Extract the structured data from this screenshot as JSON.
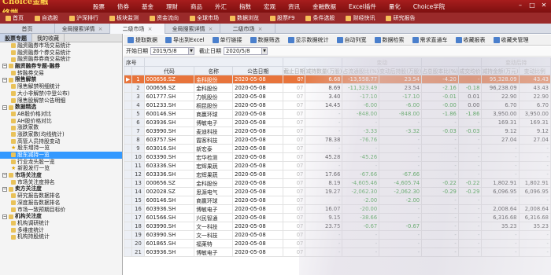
{
  "app": {
    "logo_text": "Choice金融终端",
    "menu": [
      "股票",
      "债券",
      "基金",
      "理财",
      "商品",
      "外汇",
      "指数",
      "宏观",
      "资讯",
      "金融数据",
      "Excel插件",
      "量化",
      "Choice学院"
    ],
    "window_controls": [
      "minimize-icon",
      "maximize-icon",
      "close-icon"
    ]
  },
  "quick_tools": [
    "首页",
    "自选股",
    "沪深排行",
    "板块监测",
    "资金流向",
    "全球市场",
    "数据浏览",
    "股票F9",
    "条件选股",
    "财经快讯",
    "研究报告"
  ],
  "tabs": [
    {
      "label": "首页",
      "active": false
    },
    {
      "label": "全局搜索详情",
      "active": false
    },
    {
      "label": "二级市场",
      "active": true
    },
    {
      "label": "全局搜索详情",
      "active": false
    },
    {
      "label": "二级市场",
      "active": false
    }
  ],
  "sidebar": {
    "tabs": [
      "股票专题",
      "我的收藏"
    ],
    "items": [
      {
        "label": "融资融券市场交易统计",
        "level": 2,
        "kind": "leaf"
      },
      {
        "label": "融资融券个券交易统计",
        "level": 2,
        "kind": "leaf"
      },
      {
        "label": "融资融券券商交易统计",
        "level": 2,
        "kind": "leaf"
      },
      {
        "label": "融资融券专题-融券",
        "level": 1,
        "kind": "group"
      },
      {
        "label": "转融券交易",
        "level": 2,
        "kind": "leaf"
      },
      {
        "label": "限售解禁",
        "level": 1,
        "kind": "group"
      },
      {
        "label": "限售解禁明细统计",
        "level": 2,
        "kind": "leaf"
      },
      {
        "label": "大小非解禁(中登公布)",
        "level": 2,
        "kind": "leaf"
      },
      {
        "label": "限售股解禁公告明细",
        "level": 2,
        "kind": "leaf"
      },
      {
        "label": "数据精选",
        "level": 1,
        "kind": "group"
      },
      {
        "label": "AB股价格对比",
        "level": 2,
        "kind": "leaf"
      },
      {
        "label": "AH股价格对比",
        "level": 2,
        "kind": "leaf"
      },
      {
        "label": "涨跌家数",
        "level": 2,
        "kind": "leaf"
      },
      {
        "label": "涨跌家数(均线统计)",
        "level": 2,
        "kind": "leaf"
      },
      {
        "label": "高管人员持股变动",
        "level": 2,
        "kind": "leaf"
      },
      {
        "label": "股东增持一览",
        "level": 2,
        "kind": "star"
      },
      {
        "label": "股东减持一览",
        "level": 2,
        "kind": "selected"
      },
      {
        "label": "行业龙头股一览",
        "level": 2,
        "kind": "leaf"
      },
      {
        "label": "新股发行一览",
        "level": 2,
        "kind": "star"
      },
      {
        "label": "市场关注度",
        "level": 1,
        "kind": "group"
      },
      {
        "label": "市场关注度排名",
        "level": 2,
        "kind": "leaf"
      },
      {
        "label": "卖方关注度",
        "level": 1,
        "kind": "group"
      },
      {
        "label": "研究报告数据排名",
        "level": 2,
        "kind": "leaf"
      },
      {
        "label": "深度报告数据排名",
        "level": 2,
        "kind": "leaf"
      },
      {
        "label": "市场一致预期目标价",
        "level": 2,
        "kind": "leaf"
      },
      {
        "label": "机构关注度",
        "level": 1,
        "kind": "group"
      },
      {
        "label": "机构调研统计",
        "level": 2,
        "kind": "leaf"
      },
      {
        "label": "多维度统计",
        "level": 2,
        "kind": "leaf"
      },
      {
        "label": "机构持股统计",
        "level": 2,
        "kind": "leaf"
      }
    ]
  },
  "actions": [
    "提取数据",
    "导出到Excel",
    "单行链接",
    "数据筛选",
    "显示数据统计",
    "自动列宽",
    "数据检索",
    "需求直通车",
    "收藏报表",
    "收藏夹管理"
  ],
  "filters": {
    "start_label": "开始日期",
    "start_value": "2019/5/8",
    "end_label": "截止日期",
    "end_value": "2020/5/8"
  },
  "table": {
    "headers": [
      "序号",
      "代码",
      "名称",
      "公告日期",
      "截止日期",
      "减持数量(万股)",
      "占流通股比(%)",
      "变动后持股(万股)",
      "占总股本比(%)",
      "成交均价",
      "减持金额(万元)",
      "变动比例",
      "增减持日期",
      "交易方式",
      "变动(万元)"
    ],
    "group_headers": [
      "变动",
      "变动后持"
    ],
    "rows": [
      {
        "idx": "1",
        "code": "000656.SZ",
        "name": "金科股份",
        "date": "2020-05-08",
        "c1": "0?",
        "c2": "6.68",
        "c3": "-13,558.77",
        "c4": "23.54",
        "c5": "-4.20",
        "c6": "-",
        "c7": "95,328.09",
        "c8": "43.43"
      },
      {
        "idx": "2",
        "code": "000656.SZ",
        "name": "金科股份",
        "date": "2020-05-08",
        "c1": "07",
        "c2": "8.69",
        "c3": "-11,323.49",
        "c4": "23.54",
        "c5": "-2.16",
        "c6": "-0.18",
        "c7": "96,238.09",
        "c8": "43.43"
      },
      {
        "idx": "3",
        "code": "601777.SH",
        "name": "力帆股份",
        "date": "2020-05-08",
        "c1": "07",
        "c2": "3.40",
        "c3": "-17.10",
        "c4": "-17.10",
        "c5": "-0.01",
        "c6": "0.01",
        "c7": "22.90",
        "c8": "22.90"
      },
      {
        "idx": "4",
        "code": "601233.SH",
        "name": "桐昆股份",
        "date": "2020-05-08",
        "c1": "07",
        "c2": "14.45",
        "c3": "-6.00",
        "c4": "-6.00",
        "c5": "-0.00",
        "c6": "0.00",
        "c7": "6.70",
        "c8": "6.70"
      },
      {
        "idx": "5",
        "code": "600146.SH",
        "name": "商赢环球",
        "date": "2020-05-08",
        "c1": "07",
        "c2": "-",
        "c3": "-848.00",
        "c4": "-848.00",
        "c5": "-1.86",
        "c6": "-1.86",
        "c7": "3,950.00",
        "c8": "3,950.00"
      },
      {
        "idx": "6",
        "code": "603936.SH",
        "name": "博敏电子",
        "date": "2020-05-08",
        "c1": "07",
        "c2": "-",
        "c3": "-",
        "c4": "-",
        "c5": "-",
        "c6": "-",
        "c7": "169.31",
        "c8": "169.31"
      },
      {
        "idx": "7",
        "code": "603990.SH",
        "name": "麦迪科技",
        "date": "2020-05-08",
        "c1": "07",
        "c2": "-",
        "c3": "-3.33",
        "c4": "-3.32",
        "c5": "-0.03",
        "c6": "-0.03",
        "c7": "9.12",
        "c8": "9.12"
      },
      {
        "idx": "8",
        "code": "603757.SH",
        "name": "霞客科技",
        "date": "2020-05-08",
        "c1": "07",
        "c2": "78.38",
        "c3": "-76.76",
        "c4": "-",
        "c5": "-",
        "c6": "-",
        "c7": "27.04",
        "c8": "27.04"
      },
      {
        "idx": "9",
        "code": "603016.SH",
        "name": "新宏泰",
        "date": "2020-05-08",
        "c1": "07",
        "c2": "-",
        "c3": "-",
        "c4": "-",
        "c5": "-",
        "c6": "-",
        "c7": "-",
        "c8": "-"
      },
      {
        "idx": "10",
        "code": "603390.SH",
        "name": "宏华检测",
        "date": "2020-05-08",
        "c1": "07",
        "c2": "45.28",
        "c3": "-45.26",
        "c4": "-",
        "c5": "-",
        "c6": "-",
        "c7": "-",
        "c8": "-"
      },
      {
        "idx": "11",
        "code": "603336.SH",
        "name": "宏辉果蔬",
        "date": "2020-05-08",
        "c1": "07",
        "c2": "-",
        "c3": "-",
        "c4": "-",
        "c5": "-",
        "c6": "-",
        "c7": "-",
        "c8": "-"
      },
      {
        "idx": "12",
        "code": "603336.SH",
        "name": "宏辉果蔬",
        "date": "2020-05-08",
        "c1": "07",
        "c2": "17.66",
        "c3": "-67.66",
        "c4": "-67.66",
        "c5": "-",
        "c6": "-",
        "c7": "-",
        "c8": "-"
      },
      {
        "idx": "13",
        "code": "000656.SZ",
        "name": "金科股份",
        "date": "2020-05-08",
        "c1": "07",
        "c2": "8.19",
        "c3": "-4,605.46",
        "c4": "-4,605.74",
        "c5": "-0.22",
        "c6": "-0.22",
        "c7": "1,802.91",
        "c8": "1,802.91"
      },
      {
        "idx": "14",
        "code": "002028.SZ",
        "name": "思源电气",
        "date": "2020-05-08",
        "c1": "07",
        "c2": "19.27",
        "c3": "-2,062.30",
        "c4": "-2,062.30",
        "c5": "-0.29",
        "c6": "-0.29",
        "c7": "6,096.95",
        "c8": "6,096.95"
      },
      {
        "idx": "15",
        "code": "600146.SH",
        "name": "商赢环球",
        "date": "2020-05-08",
        "c1": "07",
        "c2": "-",
        "c3": "-2.00",
        "c4": "-2.00",
        "c5": "-",
        "c6": "-",
        "c7": "-",
        "c8": "-"
      },
      {
        "idx": "16",
        "code": "603936.SH",
        "name": "博敏电子",
        "date": "2020-05-08",
        "c1": "07",
        "c2": "16.07",
        "c3": "-20.00",
        "c4": "-",
        "c5": "-",
        "c6": "-",
        "c7": "2,008.64",
        "c8": "2,008.64"
      },
      {
        "idx": "17",
        "code": "601566.SH",
        "name": "兴民智通",
        "date": "2020-05-08",
        "c1": "07",
        "c2": "9.15",
        "c3": "-38.66",
        "c4": "-",
        "c5": "-",
        "c6": "-",
        "c7": "6,316.68",
        "c8": "6,316.68"
      },
      {
        "idx": "18",
        "code": "603990.SH",
        "name": "文一科技",
        "date": "2020-05-08",
        "c1": "07",
        "c2": "23.75",
        "c3": "-0.67",
        "c4": "-0.67",
        "c5": "-",
        "c6": "-",
        "c7": "35.23",
        "c8": "35.23"
      },
      {
        "idx": "19",
        "code": "603990.SH",
        "name": "文一科技",
        "date": "2020-05-08",
        "c1": "07",
        "c2": "-",
        "c3": "-",
        "c4": "-",
        "c5": "-",
        "c6": "-",
        "c7": "-",
        "c8": "-"
      },
      {
        "idx": "20",
        "code": "601865.SH",
        "name": "福莱特",
        "date": "2020-05-08",
        "c1": "07",
        "c2": "-",
        "c3": "-",
        "c4": "-",
        "c5": "-",
        "c6": "-",
        "c7": "-",
        "c8": "-"
      },
      {
        "idx": "21",
        "code": "603936.SH",
        "name": "博敏电子",
        "date": "2020-05-08",
        "c1": "07",
        "c2": "-",
        "c3": "-",
        "c4": "-",
        "c5": "-",
        "c6": "-",
        "c7": "-",
        "c8": "-"
      }
    ]
  },
  "colors": {
    "brand": "#a71d1d",
    "selected_row": "#e8743b",
    "selection_tree": "#3399ff",
    "positive": "#d01f1f",
    "negative": "#129018"
  }
}
